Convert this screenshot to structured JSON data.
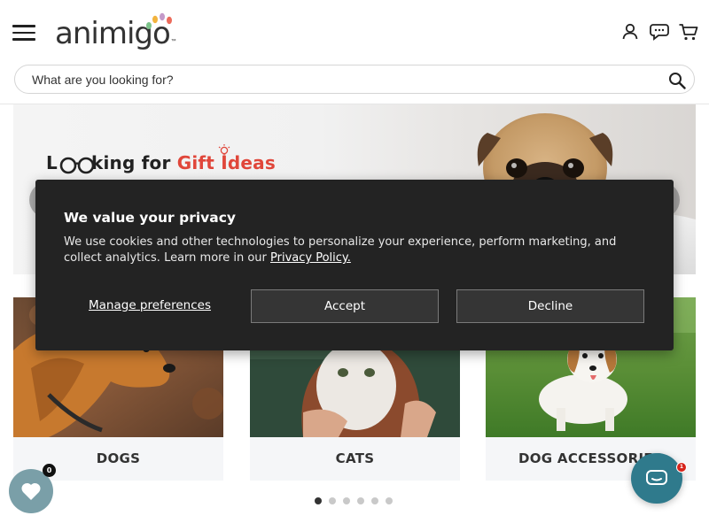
{
  "header": {
    "logo_text": "animigo",
    "logo_tm": "™",
    "icons": [
      "menu-icon",
      "user-icon",
      "chat-icon",
      "cart-icon"
    ]
  },
  "search": {
    "placeholder": "What are you looking for?",
    "value": ""
  },
  "banner": {
    "title_prefix": "L",
    "title_mid": "king for ",
    "title_highlight": "Gift Ideas"
  },
  "categories": [
    {
      "label": "DOGS"
    },
    {
      "label": "CATS"
    },
    {
      "label": "DOG ACCESSORIES"
    }
  ],
  "carousel": {
    "total_dots": 6,
    "active_index": 0
  },
  "wishlist": {
    "count": "0"
  },
  "chat": {
    "badge": "1"
  },
  "privacy": {
    "title": "We value your privacy",
    "text": "We use cookies and other technologies to personalize your experience, perform marketing, and collect analytics. Learn more in our ",
    "link": "Privacy Policy.",
    "manage": "Manage preferences",
    "accept": "Accept",
    "decline": "Decline"
  },
  "colors": {
    "modal_bg": "#232323",
    "wishlist_bg": "#7a9fa8",
    "chat_bg": "#2f7a8c",
    "accent_red": "#e0463a"
  }
}
